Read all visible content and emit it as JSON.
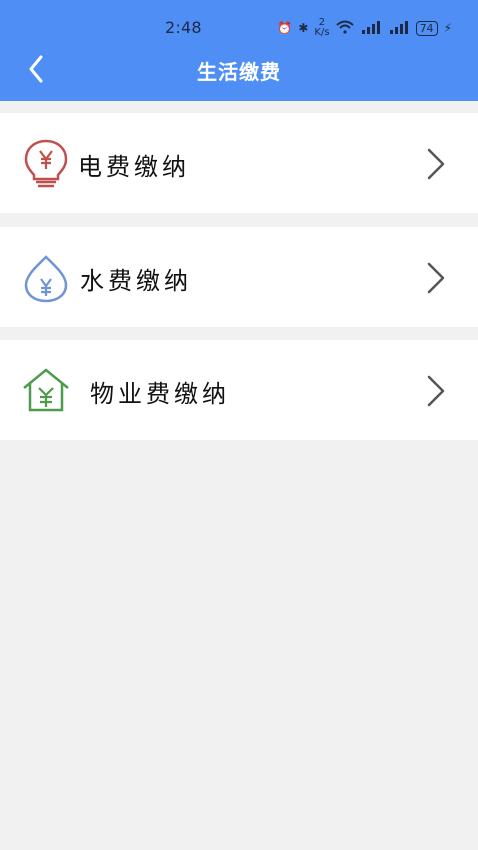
{
  "status_bar": {
    "time": "2:48",
    "net_speed_value": "2",
    "net_speed_unit": "K/s",
    "battery": "74"
  },
  "header": {
    "title": "生活缴费"
  },
  "items": [
    {
      "label": "电费缴纳",
      "icon": "electric-bulb-yuan-icon",
      "color": "#c0504d"
    },
    {
      "label": "水费缴纳",
      "icon": "water-drop-yuan-icon",
      "color": "#6f95d6"
    },
    {
      "label": "物业费缴纳",
      "icon": "house-yuan-icon",
      "color": "#4e9a4e"
    }
  ],
  "colors": {
    "header_bg": "#4f8ef5",
    "page_bg": "#f1f1f1"
  }
}
